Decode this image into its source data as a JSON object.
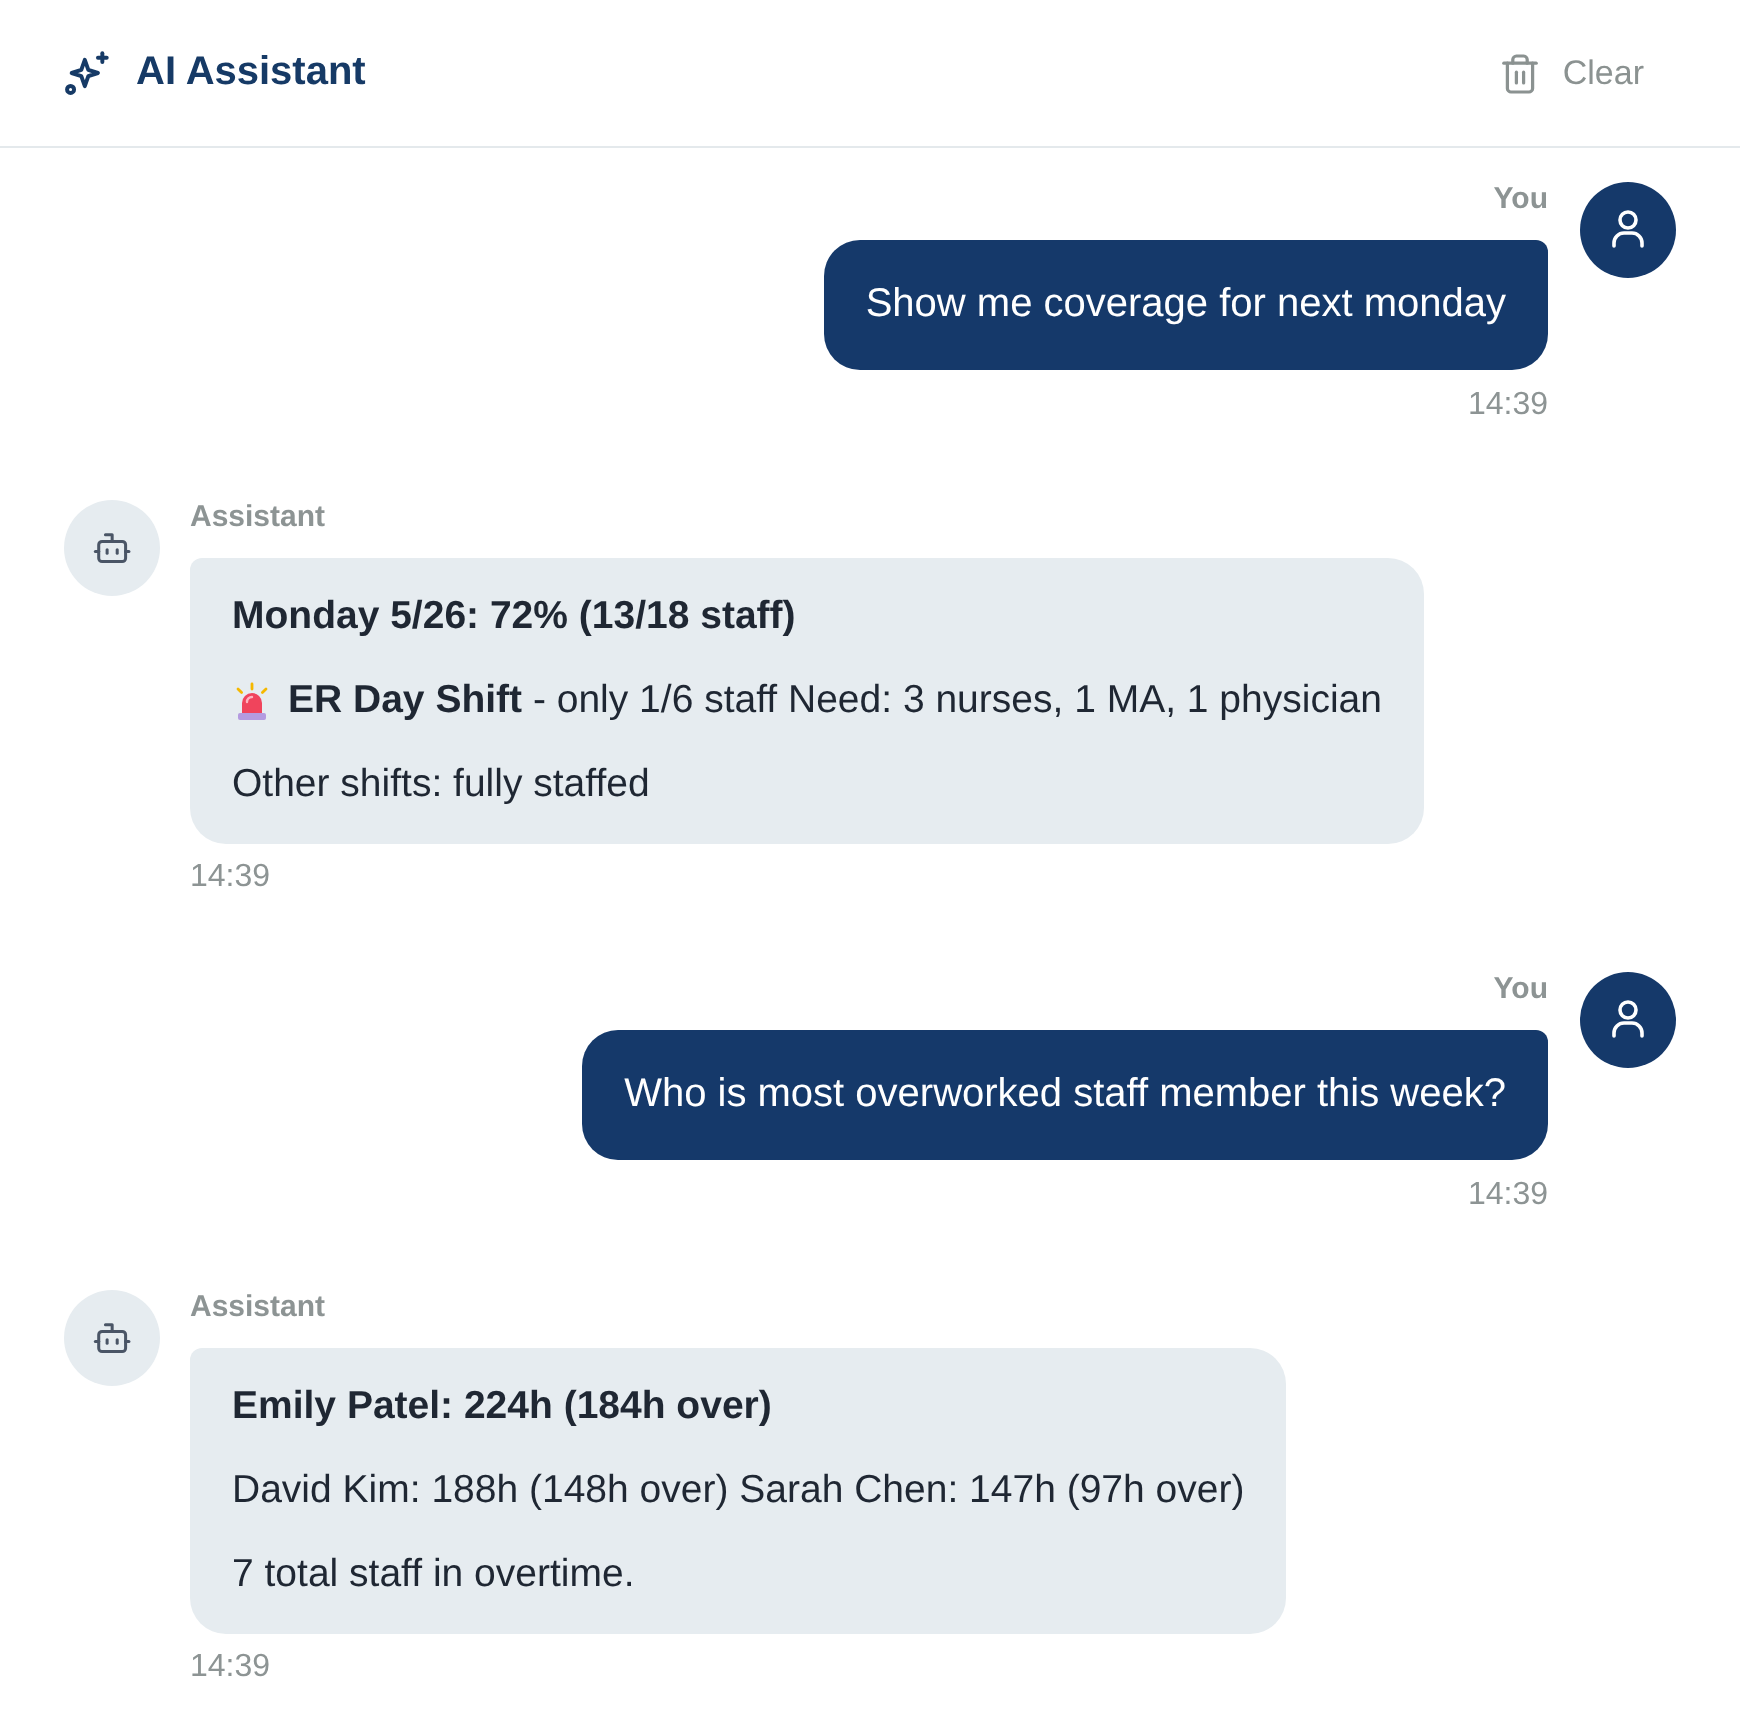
{
  "header": {
    "title": "AI Assistant",
    "clear_button": "Clear"
  },
  "messages": [
    {
      "kind": "user",
      "sender": "You",
      "text": "Show me coverage for next monday",
      "time": "14:39"
    },
    {
      "kind": "assistant",
      "sender": "Assistant",
      "lines": [
        {
          "kind": "heading",
          "text": "Monday 5/26: 72% (13/18 staff)"
        },
        {
          "kind": "alert",
          "text": "**ER Day Shift** - only 1/6 staff Need: 3 nurses, 1 MA, 1 physician"
        },
        {
          "kind": "text",
          "text": "Other shifts: fully staffed"
        }
      ],
      "time": "14:39"
    },
    {
      "kind": "user",
      "sender": "You",
      "text": "Who is most overworked staff member this week?",
      "time": "14:39"
    },
    {
      "kind": "assistant",
      "sender": "Assistant",
      "lines": [
        {
          "kind": "heading",
          "text": "Emily Patel: 224h (184h over)"
        },
        {
          "kind": "text",
          "text": "David Kim: 188h (148h over) Sarah Chen: 147h (97h over)"
        },
        {
          "kind": "text",
          "text": "7 total staff in overtime."
        }
      ],
      "time": "14:39"
    }
  ]
}
